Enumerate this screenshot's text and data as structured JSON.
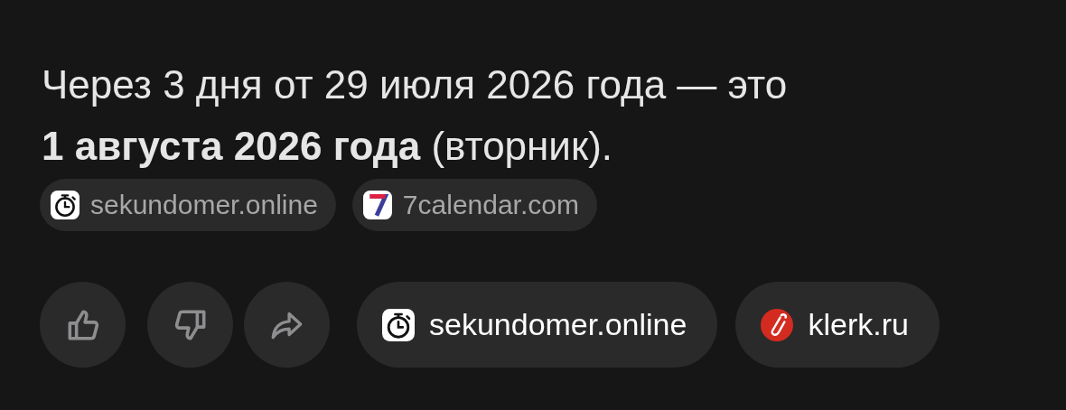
{
  "answer": "Через 3 дня от 29 июля 2026 года — это **1 августа 2026 года** (вторник).",
  "source_chips": [
    {
      "kind": "stopwatch",
      "label": "sekundomer.online"
    },
    {
      "kind": "calendar",
      "label": "7calendar.com"
    }
  ],
  "actions": [
    {
      "kind": "like"
    },
    {
      "kind": "dislike"
    },
    {
      "kind": "share"
    }
  ],
  "sources": [
    {
      "kind": "stopwatch",
      "label": "sekundomer.online"
    },
    {
      "kind": "paperclip",
      "label": "klerk.ru"
    }
  ]
}
